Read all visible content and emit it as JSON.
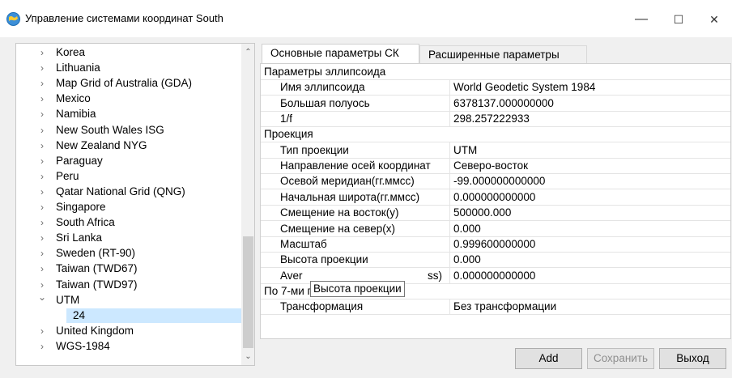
{
  "window": {
    "title": "Управление системами координат South",
    "minimize": "—",
    "maximize": "☐",
    "close": "✕"
  },
  "tree": {
    "items": [
      {
        "label": "Korea",
        "expanded": false
      },
      {
        "label": "Lithuania",
        "expanded": false
      },
      {
        "label": "Map Grid of Australia (GDA)",
        "expanded": false
      },
      {
        "label": "Mexico",
        "expanded": false
      },
      {
        "label": "Namibia",
        "expanded": false
      },
      {
        "label": "New South Wales ISG",
        "expanded": false
      },
      {
        "label": "New Zealand NYG",
        "expanded": false
      },
      {
        "label": "Paraguay",
        "expanded": false
      },
      {
        "label": "Peru",
        "expanded": false
      },
      {
        "label": "Qatar National Grid (QNG)",
        "expanded": false
      },
      {
        "label": "Singapore",
        "expanded": false
      },
      {
        "label": "South Africa",
        "expanded": false
      },
      {
        "label": "Sri Lanka",
        "expanded": false
      },
      {
        "label": "Sweden (RT-90)",
        "expanded": false
      },
      {
        "label": "Taiwan (TWD67)",
        "expanded": false
      },
      {
        "label": "Taiwan (TWD97)",
        "expanded": false
      },
      {
        "label": "UTM",
        "expanded": true
      },
      {
        "label": "24",
        "child": true,
        "selected": true
      },
      {
        "label": "United Kingdom",
        "expanded": false
      },
      {
        "label": "WGS-1984",
        "expanded": false
      }
    ],
    "arrow_collapsed": "›",
    "arrow_expanded": "⌄",
    "scroll_up": "⌃",
    "scroll_down": "⌄"
  },
  "tabs": {
    "basic": "Основные параметры СК",
    "advanced": "Расширенные параметры"
  },
  "properties": [
    {
      "type": "category",
      "label": "Параметры эллипсоида"
    },
    {
      "type": "prop",
      "name": "Имя эллипсоида",
      "value": "World Geodetic System 1984"
    },
    {
      "type": "prop",
      "name": "Большая полуось",
      "value": "6378137.000000000"
    },
    {
      "type": "prop",
      "name": "1/f",
      "value": "298.257222933"
    },
    {
      "type": "category",
      "label": "Проекция"
    },
    {
      "type": "prop",
      "name": "Тип проекции",
      "value": "UTM"
    },
    {
      "type": "prop",
      "name": "Направление осей координат",
      "value": "Северо-восток"
    },
    {
      "type": "prop",
      "name": "Осевой меридиан(гг.ммсс)",
      "value": "-99.000000000000"
    },
    {
      "type": "prop",
      "name": "Начальная широта(гг.ммсс)",
      "value": "0.000000000000"
    },
    {
      "type": "prop",
      "name": "Смещение на восток(у)",
      "value": "500000.000"
    },
    {
      "type": "prop",
      "name": "Смещение на север(х)",
      "value": "0.000"
    },
    {
      "type": "prop",
      "name": "Масштаб",
      "value": "0.999600000000"
    },
    {
      "type": "prop",
      "name": "Высота проекции",
      "value": "0.000"
    },
    {
      "type": "prop",
      "name": "Aver",
      "name_suffix": "ss)",
      "value": "0.000000000000"
    },
    {
      "type": "category",
      "label": "По 7-ми параметрам"
    },
    {
      "type": "prop",
      "name": "Трансформация",
      "value": "Без трансформации"
    }
  ],
  "tooltip": "Высота проекции",
  "buttons": {
    "add": "Add",
    "save": "Сохранить",
    "exit": "Выход"
  },
  "colors": {
    "selection": "#cce8ff",
    "window_bg": "#f0f0f0",
    "app_icon": "#3c8fd8"
  }
}
